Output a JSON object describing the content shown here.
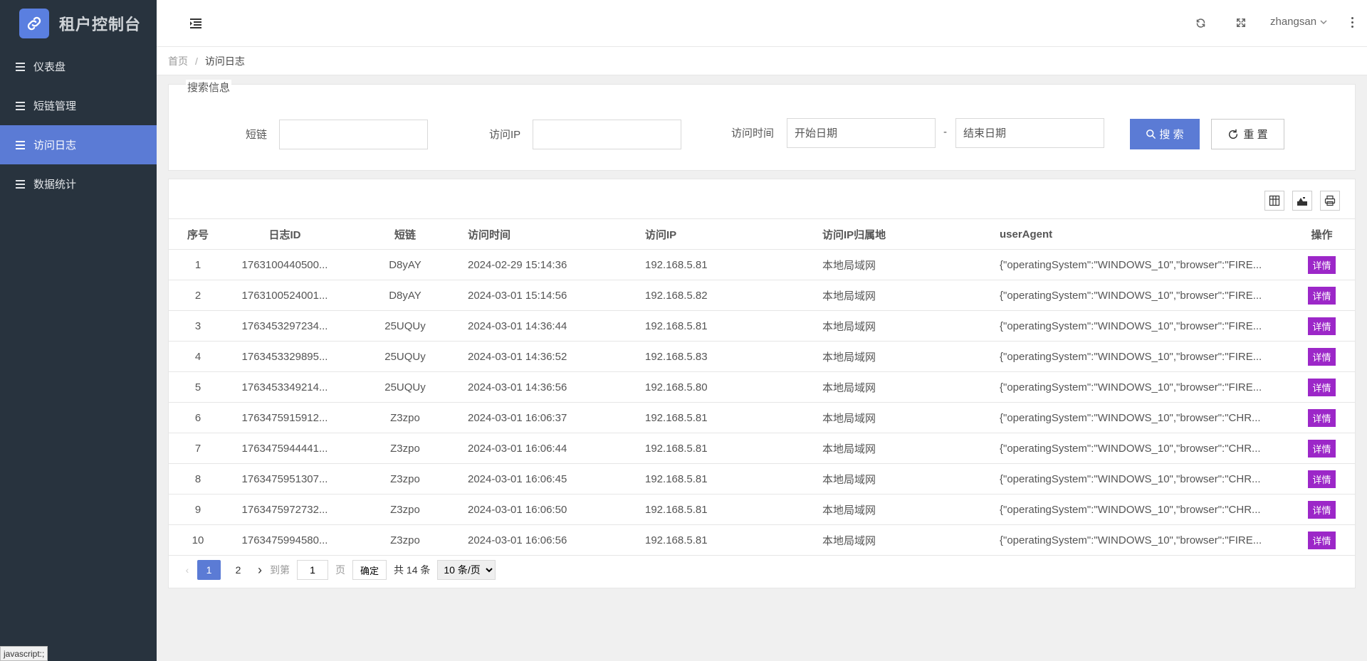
{
  "app": {
    "title": "租户控制台"
  },
  "sidebar": {
    "items": [
      {
        "label": "仪表盘"
      },
      {
        "label": "短链管理"
      },
      {
        "label": "访问日志"
      },
      {
        "label": "数据统计"
      }
    ],
    "active_index": 2
  },
  "header": {
    "username": "zhangsan"
  },
  "breadcrumb": {
    "home": "首页",
    "separator": "/",
    "current": "访问日志"
  },
  "search": {
    "legend": "搜索信息",
    "shortlink_label": "短链",
    "ip_label": "访问IP",
    "time_label": "访问时间",
    "start_placeholder": "开始日期",
    "end_placeholder": "结束日期",
    "date_separator": "-",
    "search_button": "搜 索",
    "reset_button": "重 置"
  },
  "table": {
    "columns": [
      "序号",
      "日志ID",
      "短链",
      "访问时间",
      "访问IP",
      "访问IP归属地",
      "userAgent",
      "操作"
    ],
    "action_label": "详情",
    "rows": [
      {
        "no": "1",
        "id": "1763100440500...",
        "short": "D8yAY",
        "time": "2024-02-29 15:14:36",
        "ip": "192.168.5.81",
        "loc": "本地局域网",
        "ua": "{\"operatingSystem\":\"WINDOWS_10\",\"browser\":\"FIRE..."
      },
      {
        "no": "2",
        "id": "1763100524001...",
        "short": "D8yAY",
        "time": "2024-03-01 15:14:56",
        "ip": "192.168.5.82",
        "loc": "本地局域网",
        "ua": "{\"operatingSystem\":\"WINDOWS_10\",\"browser\":\"FIRE..."
      },
      {
        "no": "3",
        "id": "1763453297234...",
        "short": "25UQUy",
        "time": "2024-03-01 14:36:44",
        "ip": "192.168.5.81",
        "loc": "本地局域网",
        "ua": "{\"operatingSystem\":\"WINDOWS_10\",\"browser\":\"FIRE..."
      },
      {
        "no": "4",
        "id": "1763453329895...",
        "short": "25UQUy",
        "time": "2024-03-01 14:36:52",
        "ip": "192.168.5.83",
        "loc": "本地局域网",
        "ua": "{\"operatingSystem\":\"WINDOWS_10\",\"browser\":\"FIRE..."
      },
      {
        "no": "5",
        "id": "1763453349214...",
        "short": "25UQUy",
        "time": "2024-03-01 14:36:56",
        "ip": "192.168.5.80",
        "loc": "本地局域网",
        "ua": "{\"operatingSystem\":\"WINDOWS_10\",\"browser\":\"FIRE..."
      },
      {
        "no": "6",
        "id": "1763475915912...",
        "short": "Z3zpo",
        "time": "2024-03-01 16:06:37",
        "ip": "192.168.5.81",
        "loc": "本地局域网",
        "ua": "{\"operatingSystem\":\"WINDOWS_10\",\"browser\":\"CHR..."
      },
      {
        "no": "7",
        "id": "1763475944441...",
        "short": "Z3zpo",
        "time": "2024-03-01 16:06:44",
        "ip": "192.168.5.81",
        "loc": "本地局域网",
        "ua": "{\"operatingSystem\":\"WINDOWS_10\",\"browser\":\"CHR..."
      },
      {
        "no": "8",
        "id": "1763475951307...",
        "short": "Z3zpo",
        "time": "2024-03-01 16:06:45",
        "ip": "192.168.5.81",
        "loc": "本地局域网",
        "ua": "{\"operatingSystem\":\"WINDOWS_10\",\"browser\":\"CHR..."
      },
      {
        "no": "9",
        "id": "1763475972732...",
        "short": "Z3zpo",
        "time": "2024-03-01 16:06:50",
        "ip": "192.168.5.81",
        "loc": "本地局域网",
        "ua": "{\"operatingSystem\":\"WINDOWS_10\",\"browser\":\"CHR..."
      },
      {
        "no": "10",
        "id": "1763475994580...",
        "short": "Z3zpo",
        "time": "2024-03-01 16:06:56",
        "ip": "192.168.5.81",
        "loc": "本地局域网",
        "ua": "{\"operatingSystem\":\"WINDOWS_10\",\"browser\":\"FIRE..."
      }
    ]
  },
  "pagination": {
    "pages": [
      "1",
      "2"
    ],
    "current": "1",
    "goto_label": "到第",
    "goto_value": "1",
    "page_unit": "页",
    "confirm_label": "确定",
    "total_label": "共 14 条",
    "page_size": "10 条/页"
  },
  "status_tip": "javascript:;",
  "colors": {
    "sidebar_bg": "#28333e",
    "accent": "#5b7bd5",
    "detail_button": "#9c27c8"
  }
}
